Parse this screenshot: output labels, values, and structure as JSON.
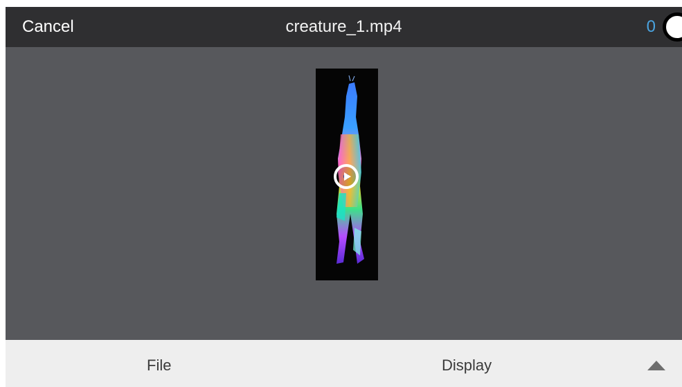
{
  "header": {
    "cancel_label": "Cancel",
    "title": "creature_1.mp4",
    "counter": "0"
  },
  "footer": {
    "file_label": "File",
    "display_label": "Display"
  },
  "icons": {
    "play": "play-icon",
    "toggle": "toggle-knob-icon",
    "expand": "triangle-up-icon"
  },
  "colors": {
    "header_bg": "#2f2f31",
    "content_bg": "#57585c",
    "footer_bg": "#eeeeee",
    "accent": "#4aa3df"
  }
}
